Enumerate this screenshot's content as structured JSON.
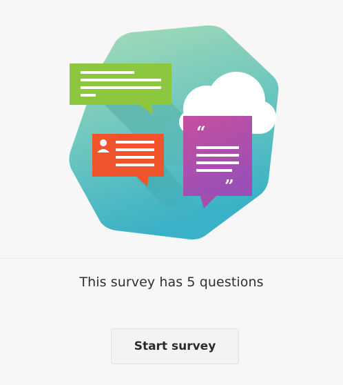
{
  "survey": {
    "question_count_text": "This survey has 5 questions",
    "start_label": "Start survey"
  },
  "illustration": {
    "icons": [
      "chat-bubble-icon",
      "cloud-icon",
      "user-icon",
      "quote-icon"
    ]
  },
  "colors": {
    "background": "#f7f7f7",
    "hexagon_light": "#8fd3c4",
    "hexagon_dark": "#3fb3c2",
    "green_bubble": "#8cc63f",
    "red_bubble": "#f0552b",
    "purple_card_top": "#c54fa8",
    "purple_card_bottom": "#9a4fb3",
    "button_bg": "#f3f3f3",
    "text": "#2f2f2f"
  }
}
